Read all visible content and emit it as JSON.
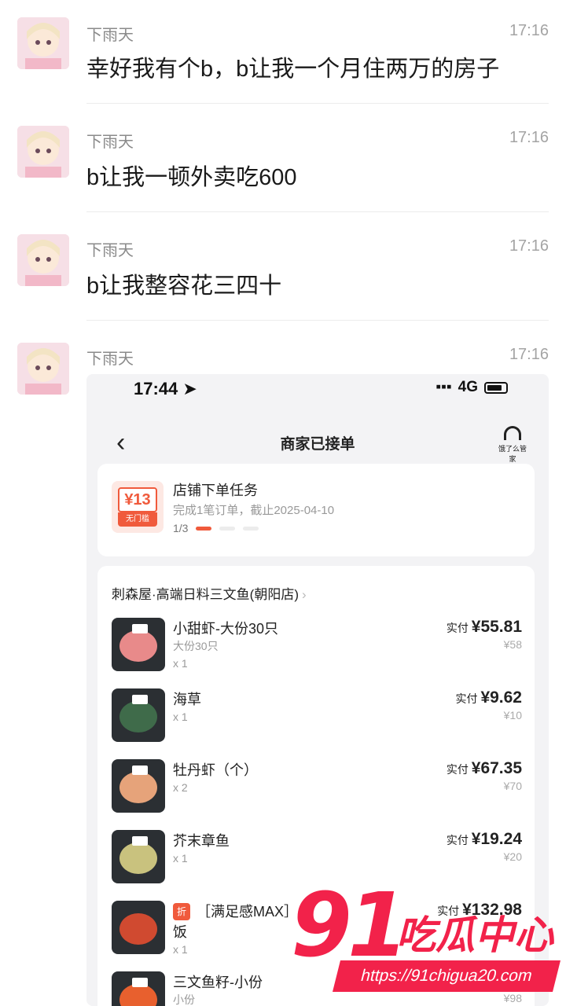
{
  "chat": {
    "messages": [
      {
        "sender": "下雨天",
        "time": "17:16",
        "text": "幸好我有个b，b让我一个月住两万的房子"
      },
      {
        "sender": "下雨天",
        "time": "17:16",
        "text": "b让我一顿外卖吃600"
      },
      {
        "sender": "下雨天",
        "time": "17:16",
        "text": "b让我整容花三四十"
      },
      {
        "sender": "下雨天",
        "time": "17:16",
        "text": ""
      }
    ]
  },
  "screenshot": {
    "status_bar": {
      "time": "17:44",
      "network": "4G"
    },
    "nav_title": "商家已接单",
    "support_label": "饿了么管家",
    "task": {
      "coupon_value": "¥13",
      "coupon_label": "无门槛",
      "title": "店铺下单任务",
      "subtitle": "完成1笔订单，截止2025-04-10",
      "progress": "1/3"
    },
    "shop_name": "刺森屋·高端日料三文鱼(朝阳店)",
    "items": [
      {
        "name": "小甜虾-大份30只",
        "spec": "大份30只",
        "qty": "x 1",
        "paid_label": "实付",
        "price": "¥55.81",
        "orig": "¥58"
      },
      {
        "name": "海草",
        "spec": "",
        "qty": "x 1",
        "paid_label": "实付",
        "price": "¥9.62",
        "orig": "¥10"
      },
      {
        "name": "牡丹虾（个）",
        "spec": "",
        "qty": "x 2",
        "paid_label": "实付",
        "price": "¥67.35",
        "orig": "¥70"
      },
      {
        "name": "芥末章鱼",
        "spec": "",
        "qty": "x 1",
        "paid_label": "实付",
        "price": "¥19.24",
        "orig": "¥20"
      },
      {
        "name": "［满足感MAX］",
        "name2": "饭",
        "badge": "折",
        "spec": "",
        "qty": "x 1",
        "paid_label": "实付",
        "price": "¥132.98",
        "orig": ""
      },
      {
        "name": "三文鱼籽-小份",
        "spec": "小份",
        "qty": "",
        "paid_label": "",
        "price": "",
        "orig": "¥98"
      }
    ]
  },
  "watermark": {
    "number": "91",
    "name": "吃瓜中心",
    "url": "https://91chigua20.com"
  },
  "colors": {
    "accent": "#f05a3c",
    "watermark": "#f2224a",
    "divider": "#ececec"
  }
}
